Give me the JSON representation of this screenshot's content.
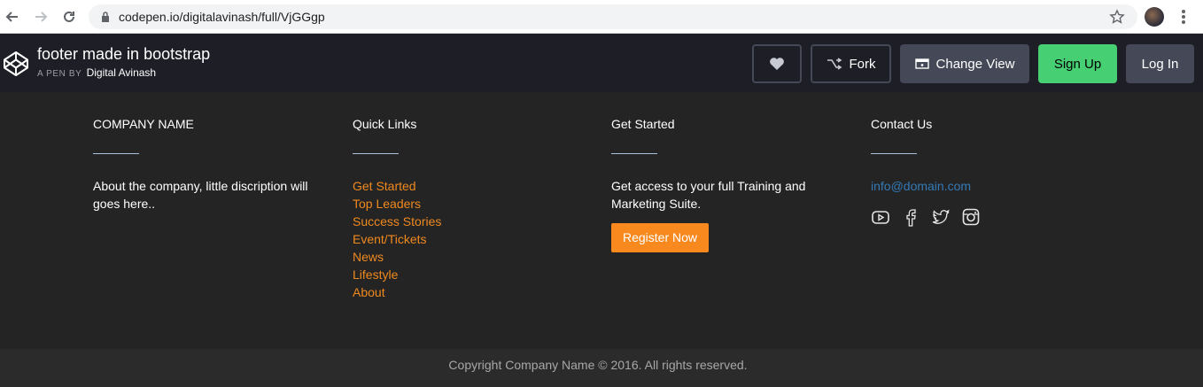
{
  "browser": {
    "url": "codepen.io/digitalavinash/full/VjGGgp"
  },
  "codepen": {
    "title": "footer made in bootstrap",
    "by_label": "A PEN BY",
    "author": "Digital Avinash",
    "fork_label": "Fork",
    "change_view_label": "Change View",
    "signup_label": "Sign Up",
    "login_label": "Log In",
    "colors": {
      "header_bg": "#1e1f26",
      "signup": "#47cf73",
      "button": "#444857"
    }
  },
  "footer": {
    "company": {
      "heading": "COMPANY NAME",
      "text": "About the company, little discription will goes here.."
    },
    "quick_links": {
      "heading": "Quick Links",
      "items": [
        "Get Started",
        "Top Leaders",
        "Success Stories",
        "Event/Tickets",
        "News",
        "Lifestyle",
        "About"
      ]
    },
    "get_started": {
      "heading": "Get Started",
      "text": "Get access to your full Training and Marketing Suite.",
      "button": "Register Now"
    },
    "contact": {
      "heading": "Contact Us",
      "email": "info@domain.com",
      "social_icons": [
        "youtube-icon",
        "facebook-icon",
        "twitter-icon",
        "instagram-icon"
      ]
    },
    "copyright": "Copyright Company Name © 2016. All rights reserved.",
    "colors": {
      "link": "#f0891e",
      "button": "#f7891f",
      "email": "#337ab7",
      "bg": "#242424"
    }
  }
}
